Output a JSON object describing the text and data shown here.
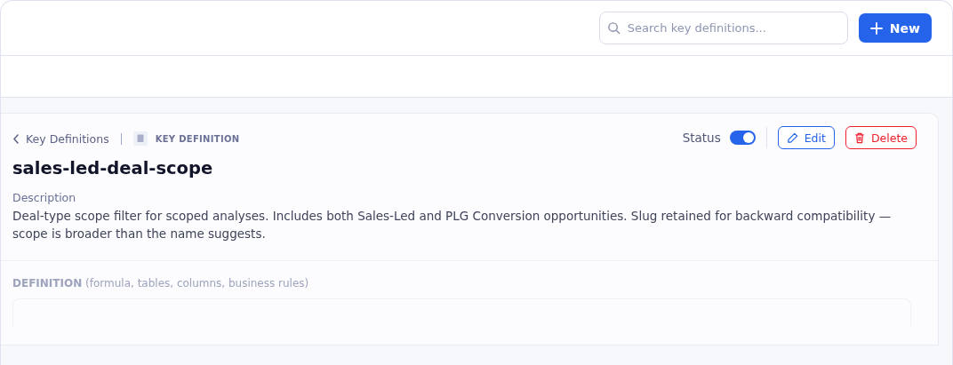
{
  "search": {
    "placeholder": "Search key definitions..."
  },
  "new_button": {
    "label": "New"
  },
  "breadcrumb": {
    "back_label": "Key Definitions",
    "type_label": "KEY DEFINITION"
  },
  "status": {
    "label": "Status",
    "on": true
  },
  "actions": [
    {
      "kind": "edit",
      "label": "Edit"
    },
    {
      "kind": "delete",
      "label": "Delete"
    }
  ],
  "title": "sales-led-deal-scope",
  "description": {
    "label": "Description",
    "text": "Deal-type scope filter for scoped analyses. Includes both Sales-Led and PLG Conversion opportunities. Slug retained for backward compatibility — scope is broader than the name suggests."
  },
  "definition": {
    "label": "**DEFINITION** (formula, tables, columns, business rules)"
  }
}
